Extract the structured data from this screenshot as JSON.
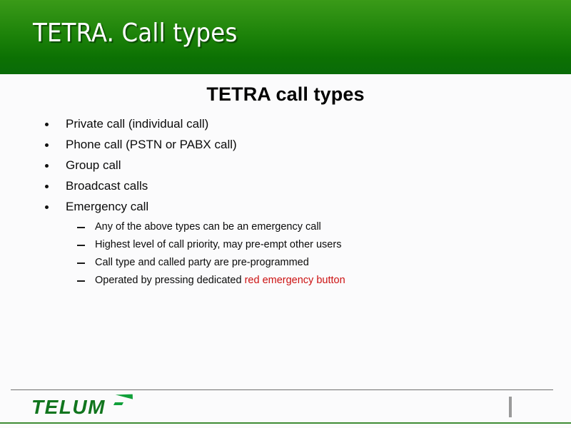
{
  "slide": {
    "header": {
      "title": "TETRA. Call types",
      "gradient_top": "#3a9a18",
      "gradient_bottom": "#0a6b09",
      "title_color": "#ffffff"
    },
    "heading": "TETRA call types",
    "bullets": [
      {
        "text": "Private call (individual call)"
      },
      {
        "text": "Phone call (PSTN or PABX call)"
      },
      {
        "text": "Group call"
      },
      {
        "text": "Broadcast calls"
      },
      {
        "text": "Emergency call"
      }
    ],
    "sub_bullets": [
      {
        "text": "Any of the above types can be an emergency call",
        "highlight": ""
      },
      {
        "text": "Highest level of call priority, may pre-empt other users",
        "highlight": ""
      },
      {
        "text": "Call type and called party are pre-programmed",
        "highlight": ""
      },
      {
        "text": "Operated by pressing dedicated ",
        "highlight": "red emergency button"
      }
    ],
    "footer": {
      "logo_text": "TELUM",
      "logo_color": "#11751e",
      "swoosh_color": "#11a03a",
      "rule_color": "#6f6f6f",
      "bottom_rule_color": "#3f8c34",
      "page_marker_color": "#9a9a9a"
    },
    "accent_red": "#cc1111",
    "body_background": "#fbfbfc"
  }
}
